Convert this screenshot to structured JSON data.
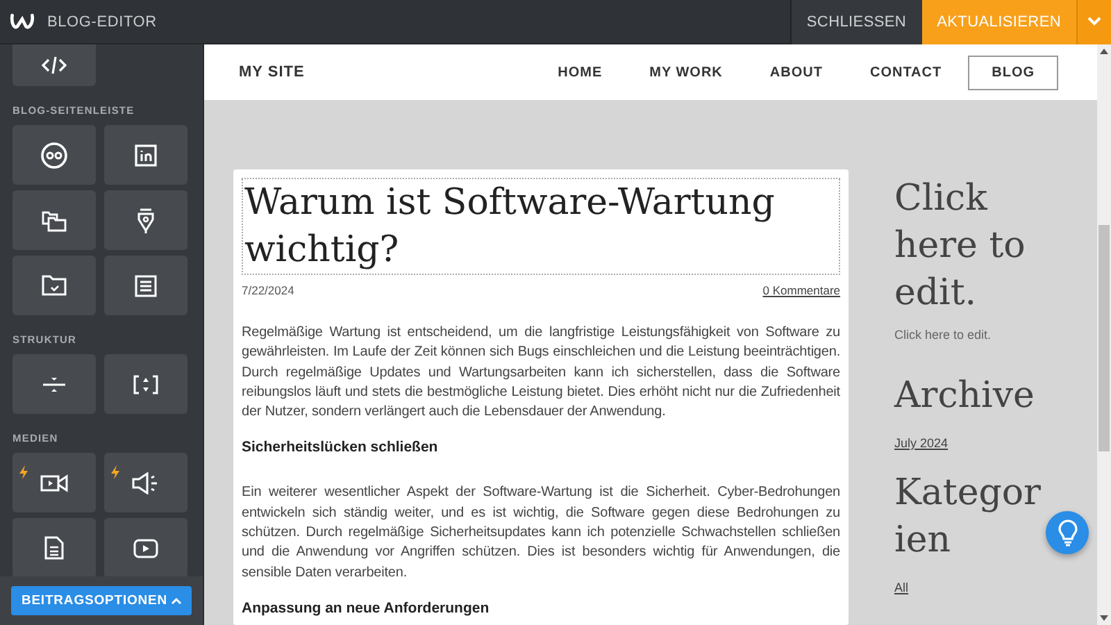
{
  "topbar": {
    "title": "BLOG-EDITOR",
    "buttons": [
      {
        "label": "SCHLIESSEN",
        "kind": "plain"
      },
      {
        "label": "AKTUALISIEREN",
        "kind": "primary"
      }
    ]
  },
  "sidebar": {
    "top_tiles": [
      {
        "kind": "code",
        "premium": false
      }
    ],
    "sections": [
      {
        "label": "BLOG-SEITENLEISTE",
        "tiles": [
          {
            "kind": "flickr",
            "premium": false
          },
          {
            "kind": "linkedin",
            "premium": false
          },
          {
            "kind": "folders",
            "premium": false
          },
          {
            "kind": "pen",
            "premium": false
          },
          {
            "kind": "folder",
            "premium": false
          },
          {
            "kind": "list",
            "premium": false
          }
        ]
      },
      {
        "label": "STRUKTUR",
        "tiles": [
          {
            "kind": "divider",
            "premium": false
          },
          {
            "kind": "spacer",
            "premium": false
          }
        ]
      },
      {
        "label": "MEDIEN",
        "tiles": [
          {
            "kind": "video",
            "premium": true
          },
          {
            "kind": "audio",
            "premium": true
          },
          {
            "kind": "document",
            "premium": false
          },
          {
            "kind": "youtube",
            "premium": false
          }
        ]
      }
    ],
    "bottom_button": "BEITRAGSOPTIONEN"
  },
  "site": {
    "name": "MY SITE",
    "nav": [
      {
        "label": "HOME",
        "selected": false
      },
      {
        "label": "MY WORK",
        "selected": false
      },
      {
        "label": "ABOUT",
        "selected": false
      },
      {
        "label": "CONTACT",
        "selected": false
      },
      {
        "label": "BLOG",
        "selected": true
      }
    ]
  },
  "post": {
    "title": "Warum ist Software-Wartung wichtig?",
    "date": "7/22/2024",
    "comments": "0 Kommentare",
    "blocks": [
      {
        "kind": "paragraph",
        "text": "Regelmäßige Wartung ist entscheidend, um die langfristige Leistungsfähigkeit von Software zu gewährleisten. Im Laufe der Zeit können sich Bugs einschleichen und die Leistung beeinträchtigen. Durch regelmäßige Updates und Wartungsarbeiten kann ich sicherstellen, dass die Software reibungslos läuft und stets die bestmögliche Leistung bietet. Dies erhöht nicht nur die Zufriedenheit der Nutzer, sondern verlängert auch die Lebensdauer der Anwendung."
      },
      {
        "kind": "heading",
        "text": "Sicherheitslücken schließen"
      },
      {
        "kind": "paragraph",
        "text": "Ein weiterer wesentlicher Aspekt der Software-Wartung ist die Sicherheit. Cyber-Bedrohungen entwickeln sich ständig weiter, und es ist wichtig, die Software gegen diese Bedrohungen zu schützen. Durch regelmäßige Sicherheitsupdates kann ich potenzielle Schwachstellen schließen und die Anwendung vor Angriffen schützen. Dies ist besonders wichtig für Anwendungen, die sensible Daten verarbeiten."
      },
      {
        "kind": "heading",
        "text": "Anpassung an neue Anforderungen"
      }
    ]
  },
  "blog_sidebar": {
    "edit_title": "Click here to edit.",
    "edit_text": "Click here to edit.",
    "archive_title": "Archive",
    "archive_link": "July 2024",
    "categories_title": "Kategorien",
    "categories_link": "All"
  }
}
